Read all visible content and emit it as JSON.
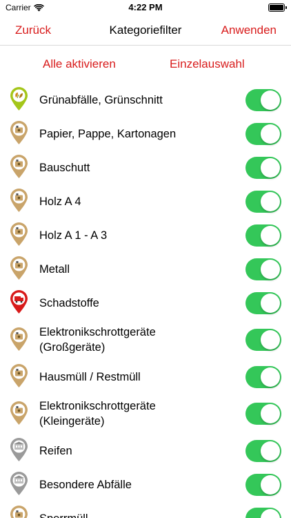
{
  "status_bar": {
    "carrier": "Carrier",
    "time": "4:22 PM",
    "battery_level": 1.0
  },
  "nav": {
    "back_label": "Zurück",
    "title": "Kategoriefilter",
    "apply_label": "Anwenden"
  },
  "actions": {
    "activate_all": "Alle aktivieren",
    "single_select": "Einzelauswahl"
  },
  "colors": {
    "accent": "#d81b1b",
    "toggle_on": "#34c759"
  },
  "categories": [
    {
      "label": "Grünabfälle, Grünschnitt",
      "icon": "leaf-pin-icon",
      "enabled": true
    },
    {
      "label": "Papier, Pappe, Kartonagen",
      "icon": "container-pin-icon",
      "enabled": true
    },
    {
      "label": "Bauschutt",
      "icon": "container-pin-icon",
      "enabled": true
    },
    {
      "label": "Holz A 4",
      "icon": "container-pin-icon",
      "enabled": true
    },
    {
      "label": "Holz A 1 - A 3",
      "icon": "container-pin-icon",
      "enabled": true
    },
    {
      "label": "Metall",
      "icon": "container-pin-icon",
      "enabled": true
    },
    {
      "label": "Schadstoffe",
      "icon": "hazard-truck-pin-icon",
      "enabled": true
    },
    {
      "label": "Elektronikschrottgeräte\n(Großgeräte)",
      "icon": "container-pin-icon",
      "enabled": true
    },
    {
      "label": "Hausmüll / Restmüll",
      "icon": "container-pin-icon",
      "enabled": true
    },
    {
      "label": "Elektronikschrottgeräte\n(Kleingeräte)",
      "icon": "container-pin-icon",
      "enabled": true
    },
    {
      "label": "Reifen",
      "icon": "building-pin-icon",
      "enabled": true
    },
    {
      "label": "Besondere Abfälle",
      "icon": "building-pin-icon",
      "enabled": true
    },
    {
      "label": "Sperrmüll",
      "icon": "container-pin-icon",
      "enabled": true
    }
  ]
}
